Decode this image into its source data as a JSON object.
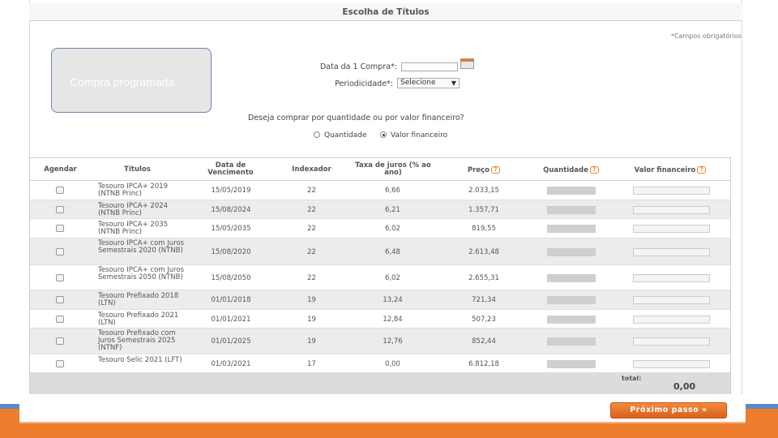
{
  "page_title": "Escolha de Títulos",
  "required_note": "*Campos obrigatórios",
  "callout": "Compra programada",
  "form": {
    "first_purchase_label": "Data da 1 Compra*:",
    "first_purchase_value": "",
    "periodicity_label": "Periodicidade*:",
    "periodicity_value": "Selecione",
    "question": "Deseja comprar por quantidade ou por valor financeiro?",
    "options": [
      {
        "label": "Quantidade",
        "selected": false
      },
      {
        "label": "Valor financeiro",
        "selected": true
      }
    ]
  },
  "table": {
    "headers": {
      "schedule": "Agendar",
      "titles": "Títulos",
      "maturity": "Data de Vencimento",
      "indexer": "Indexador",
      "rate": "Taxa de juros (% ao ano)",
      "price": "Preço",
      "quantity": "Quantidade",
      "financial_value": "Valor financeiro"
    },
    "help_icon_text": "?",
    "rows": [
      {
        "title": "Tesouro IPCA+ 2019 (NTNB Princ)",
        "maturity": "15/05/2019",
        "indexer": "22",
        "rate": "6,66",
        "price": "2.033,15"
      },
      {
        "title": "Tesouro IPCA+ 2024 (NTNB Princ)",
        "maturity": "15/08/2024",
        "indexer": "22",
        "rate": "6,21",
        "price": "1.357,71"
      },
      {
        "title": "Tesouro IPCA+ 2035 (NTNB Princ)",
        "maturity": "15/05/2035",
        "indexer": "22",
        "rate": "6,02",
        "price": "819,55"
      },
      {
        "title": "Tesouro IPCA+ com Juros Semestrais 2020 (NTNB)",
        "maturity": "15/08/2020",
        "indexer": "22",
        "rate": "6,48",
        "price": "2.613,48"
      },
      {
        "title": "Tesouro IPCA+ com Juros Semestrais 2050 (NTNB)",
        "maturity": "15/08/2050",
        "indexer": "22",
        "rate": "6,02",
        "price": "2.655,31"
      },
      {
        "title": "Tesouro Prefixado 2018 (LTN)",
        "maturity": "01/01/2018",
        "indexer": "19",
        "rate": "13,24",
        "price": "721,34"
      },
      {
        "title": "Tesouro Prefixado 2021 (LTN)",
        "maturity": "01/01/2021",
        "indexer": "19",
        "rate": "12,84",
        "price": "507,23"
      },
      {
        "title": "Tesouro Prefixado com Juros Semestrais 2025 (NTNF)",
        "maturity": "01/01/2025",
        "indexer": "19",
        "rate": "12,76",
        "price": "852,44"
      },
      {
        "title": "Tesouro Selic 2021 (LFT)",
        "maturity": "01/03/2021",
        "indexer": "17",
        "rate": "0,00",
        "price": "6.812,18"
      }
    ],
    "total_label": "total:",
    "total_value": "0,00"
  },
  "next_button": "Próximo passo »",
  "colors": {
    "accent": "#ef7d2e",
    "blue": "#5b8bc6",
    "callout_border": "#6d86a8"
  }
}
